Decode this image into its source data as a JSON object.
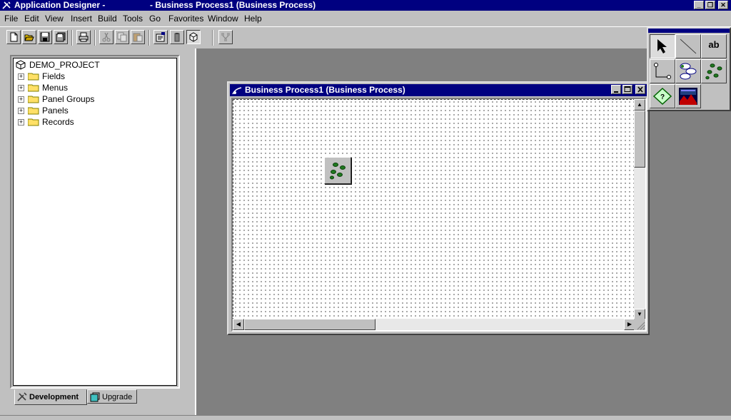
{
  "window": {
    "app_title": "Application Designer -",
    "doc_title": "- Business Process1 (Business Process)",
    "controls": [
      "minimize",
      "restore",
      "close"
    ]
  },
  "menu": [
    "File",
    "Edit",
    "View",
    "Insert",
    "Build",
    "Tools",
    "Go",
    "Favorites",
    "Window",
    "Help"
  ],
  "toolbar": {
    "buttons": [
      "new-icon",
      "open-icon",
      "save-icon",
      "save-all-icon",
      "print-icon",
      "cut-icon",
      "copy-icon",
      "paste-icon",
      "properties-icon",
      "build-icon",
      "project-workspace-icon",
      "layout-icon"
    ]
  },
  "project": {
    "root": "DEMO_PROJECT",
    "folders": [
      "Fields",
      "Menus",
      "Panel Groups",
      "Panels",
      "Records"
    ]
  },
  "tabs": [
    "Development",
    "Upgrade"
  ],
  "child_window": {
    "title": "Business Process1 (Business Process)"
  },
  "palette": {
    "items": [
      "pointer-icon",
      "line-icon",
      "ab",
      "link-icon",
      "business-process-icon",
      "activity-icon",
      "decision-icon",
      "image-icon"
    ],
    "text_tool": "ab"
  },
  "colors": {
    "title_bar": "#000080",
    "desktop": "#c0c0c0",
    "mdi_background": "#808080"
  }
}
